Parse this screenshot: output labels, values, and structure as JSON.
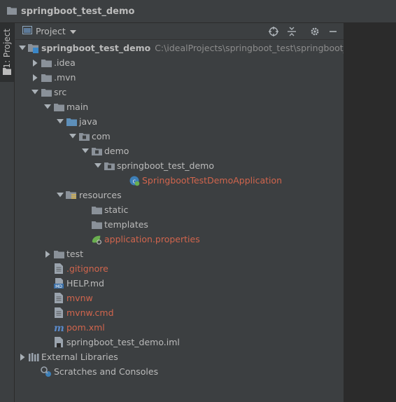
{
  "window": {
    "title": "springboot_test_demo"
  },
  "tool_strip": {
    "project_tab_label": "1: Project"
  },
  "toolbar": {
    "view_label": "Project"
  },
  "tree": [
    {
      "label": "springboot_test_demo",
      "path": "C:\\idealProjects\\springboot_test\\springboot_test_",
      "icon": "module-folder-icon",
      "arrow": "expanded",
      "style": "bold"
    },
    {
      "label": ".idea",
      "icon": "folder-icon",
      "arrow": "collapsed",
      "style": "normal"
    },
    {
      "label": ".mvn",
      "icon": "folder-icon",
      "arrow": "collapsed",
      "style": "normal"
    },
    {
      "label": "src",
      "icon": "folder-icon",
      "arrow": "expanded",
      "style": "normal"
    },
    {
      "label": "main",
      "icon": "folder-icon",
      "arrow": "expanded",
      "style": "normal"
    },
    {
      "label": "java",
      "icon": "source-folder-icon",
      "arrow": "expanded",
      "style": "normal"
    },
    {
      "label": "com",
      "icon": "package-icon",
      "arrow": "expanded",
      "style": "normal"
    },
    {
      "label": "demo",
      "icon": "package-icon",
      "arrow": "expanded",
      "style": "normal"
    },
    {
      "label": "springboot_test_demo",
      "icon": "package-icon",
      "arrow": "expanded",
      "style": "normal"
    },
    {
      "label": "SpringbootTestDemoApplication",
      "icon": "spring-class-icon",
      "arrow": "none",
      "style": "red"
    },
    {
      "label": "resources",
      "icon": "resources-folder-icon",
      "arrow": "expanded",
      "style": "normal"
    },
    {
      "label": "static",
      "icon": "folder-icon",
      "arrow": "none",
      "style": "normal"
    },
    {
      "label": "templates",
      "icon": "folder-icon",
      "arrow": "none",
      "style": "normal"
    },
    {
      "label": "application.properties",
      "icon": "spring-properties-icon",
      "arrow": "none",
      "style": "red"
    },
    {
      "label": "test",
      "icon": "folder-icon",
      "arrow": "collapsed",
      "style": "normal"
    },
    {
      "label": ".gitignore",
      "icon": "text-file-icon",
      "arrow": "none",
      "style": "red"
    },
    {
      "label": "HELP.md",
      "icon": "markdown-file-icon",
      "arrow": "none",
      "style": "normal"
    },
    {
      "label": "mvnw",
      "icon": "text-file-icon",
      "arrow": "none",
      "style": "red"
    },
    {
      "label": "mvnw.cmd",
      "icon": "text-file-icon",
      "arrow": "none",
      "style": "red"
    },
    {
      "label": "pom.xml",
      "icon": "maven-icon",
      "arrow": "none",
      "style": "red"
    },
    {
      "label": "springboot_test_demo.iml",
      "icon": "iml-file-icon",
      "arrow": "none",
      "style": "normal"
    },
    {
      "label": "External Libraries",
      "icon": "libraries-icon",
      "arrow": "collapsed",
      "style": "normal"
    },
    {
      "label": "Scratches and Consoles",
      "icon": "scratches-icon",
      "arrow": "none",
      "style": "normal"
    }
  ],
  "colors": {
    "modified_text": "#d1654d",
    "text": "#bbbbbb",
    "folder": "#8a9199",
    "source_folder": "#5d8fba",
    "spring": "#6aaf4f"
  }
}
